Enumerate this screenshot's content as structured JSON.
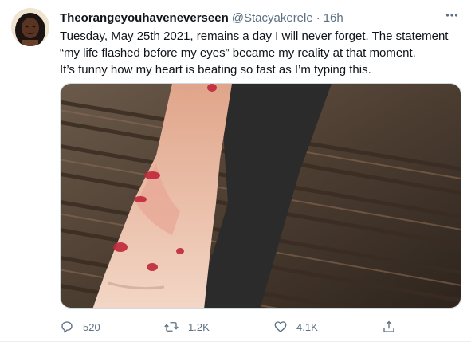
{
  "tweet": {
    "display_name": "Theorangeyouhaveneverseen",
    "handle": "@Stacyakerele",
    "separator": "·",
    "time": "16h",
    "text_lines": [
      "Tuesday, May 25th 2021, remains a day I will never forget. The statement",
      "“my life flashed before my eyes” became my reality at that moment.",
      "It’s funny how my heart is beating so fast as I’m typing this."
    ]
  },
  "actions": {
    "reply_count": "520",
    "retweet_count": "1.2K",
    "like_count": "4.1K"
  },
  "icons": {
    "more": "more-dots-icon",
    "reply": "reply-icon",
    "retweet": "retweet-icon",
    "like": "heart-icon",
    "share": "share-icon"
  },
  "colors": {
    "text": "#0f1419",
    "secondary": "#5b7083",
    "border": "#cfd9de"
  }
}
